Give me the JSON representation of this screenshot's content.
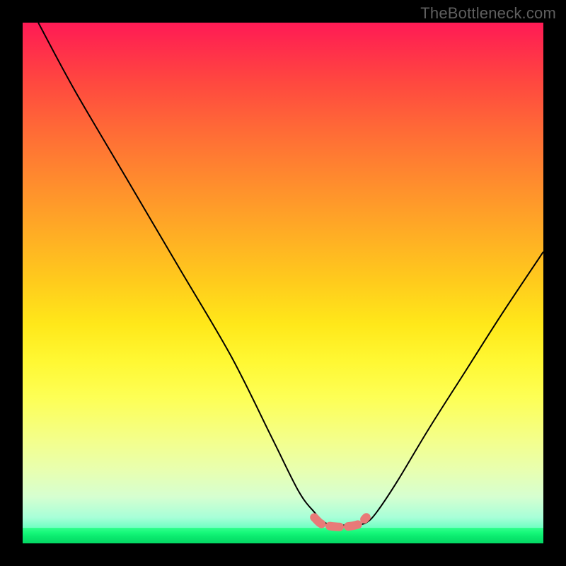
{
  "watermark": "TheBottleneck.com",
  "chart_data": {
    "type": "line",
    "title": "",
    "xlabel": "",
    "ylabel": "",
    "xlim": [
      0,
      100
    ],
    "ylim": [
      0,
      100
    ],
    "series": [
      {
        "name": "bottleneck-curve",
        "x": [
          3,
          10,
          20,
          30,
          40,
          48,
          53,
          56,
          58,
          60,
          62,
          64,
          66,
          68,
          72,
          78,
          85,
          92,
          100
        ],
        "y": [
          100,
          87,
          70,
          53,
          36,
          20,
          10,
          6,
          4,
          3.5,
          3.5,
          3.5,
          4,
          6,
          12,
          22,
          33,
          44,
          56
        ]
      },
      {
        "name": "optimal-range-marker",
        "x": [
          56,
          57,
          58,
          60,
          62,
          64,
          65,
          66
        ],
        "y": [
          5,
          4,
          3.5,
          3.2,
          3.2,
          3.5,
          4,
          5
        ]
      }
    ],
    "background_gradient": {
      "top": "#ff1a55",
      "middle": "#ffe81a",
      "bottom": "#00ff7b"
    }
  }
}
